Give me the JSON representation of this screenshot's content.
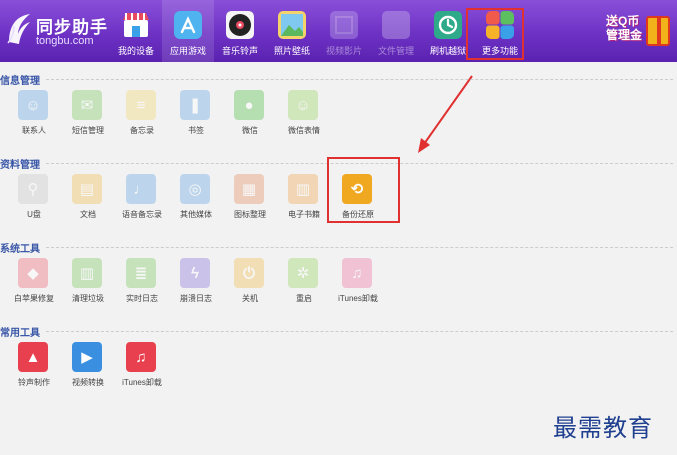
{
  "header": {
    "logo_title": "同步助手",
    "logo_sub": "tongbu.com",
    "nav": [
      {
        "label": "我的设备",
        "icon": "store-icon",
        "color": "#e84a5f"
      },
      {
        "label": "应用游戏",
        "icon": "appstore-icon",
        "color": "#3aa0e8"
      },
      {
        "label": "音乐铃声",
        "icon": "music-disc-icon",
        "color": "#222222"
      },
      {
        "label": "照片壁纸",
        "icon": "photo-icon",
        "color": "#5bb85c"
      },
      {
        "label": "视频影片",
        "icon": "video-icon",
        "color": "#8a7cc8"
      },
      {
        "label": "文件管理",
        "icon": "folder-icon",
        "color": "#a68bd0"
      },
      {
        "label": "刷机越狱",
        "icon": "flash-icon",
        "color": "#2eaa8a"
      },
      {
        "label": "更多功能",
        "icon": "more-icon",
        "color": "#f0a030"
      }
    ],
    "promo_text": "送Q币 管理金"
  },
  "sections": [
    {
      "title": "信息管理",
      "items": [
        {
          "label": "联系人",
          "icon": "contacts-icon",
          "color": "#7fb4e6",
          "glyph": "☺"
        },
        {
          "label": "短信管理",
          "icon": "sms-icon",
          "color": "#8fd07a",
          "glyph": "✉"
        },
        {
          "label": "备忘录",
          "icon": "memo-icon",
          "color": "#f0dc8a",
          "glyph": "≡"
        },
        {
          "label": "书签",
          "icon": "bookmark-icon",
          "color": "#7fb4e6",
          "glyph": "❚"
        },
        {
          "label": "微信",
          "icon": "wechat-icon",
          "color": "#6cc864",
          "glyph": "●"
        },
        {
          "label": "微信表情",
          "icon": "emoji-icon",
          "color": "#a8d87a",
          "glyph": "☺"
        }
      ]
    },
    {
      "title": "资料管理",
      "items": [
        {
          "label": "U盘",
          "icon": "usb-icon",
          "color": "#cfcfcf",
          "glyph": "⚲"
        },
        {
          "label": "文档",
          "icon": "document-icon",
          "color": "#f3c66a",
          "glyph": "▤"
        },
        {
          "label": "语音备忘录",
          "icon": "voice-memo-icon",
          "color": "#7fb4e6",
          "glyph": "♩"
        },
        {
          "label": "其他媒体",
          "icon": "media-icon",
          "color": "#7fb4e6",
          "glyph": "◎"
        },
        {
          "label": "图标整理",
          "icon": "icon-arrange-icon",
          "color": "#e8a07a",
          "glyph": "▦"
        },
        {
          "label": "电子书籍",
          "icon": "ebook-icon",
          "color": "#f0b36a",
          "glyph": "▥"
        },
        {
          "label": "备份还原",
          "icon": "backup-restore-icon",
          "color": "#f0a820",
          "glyph": "⟲"
        }
      ]
    },
    {
      "title": "系统工具",
      "items": [
        {
          "label": "白苹果修复",
          "icon": "apple-repair-icon",
          "color": "#ee7f8a",
          "glyph": "◆"
        },
        {
          "label": "清理垃圾",
          "icon": "trash-icon",
          "color": "#8fd07a",
          "glyph": "▥"
        },
        {
          "label": "实时日志",
          "icon": "log-icon",
          "color": "#8fd07a",
          "glyph": "≣"
        },
        {
          "label": "崩溃日志",
          "icon": "crash-log-icon",
          "color": "#9a8ae0",
          "glyph": "ϟ"
        },
        {
          "label": "关机",
          "icon": "power-icon",
          "color": "#f3c66a",
          "glyph": "⏻"
        },
        {
          "label": "重启",
          "icon": "restart-icon",
          "color": "#a8d87a",
          "glyph": "✲"
        },
        {
          "label": "iTunes卸载",
          "icon": "itunes-uninstall-icon",
          "color": "#ee8ab0",
          "glyph": "♫"
        }
      ]
    },
    {
      "title": "常用工具",
      "items": [
        {
          "label": "铃声制作",
          "icon": "ringtone-icon",
          "color": "#e8404f",
          "glyph": "▲"
        },
        {
          "label": "视频转换",
          "icon": "video-convert-icon",
          "color": "#3a8fe0",
          "glyph": "▶"
        },
        {
          "label": "iTunes卸载",
          "icon": "itunes-icon",
          "color": "#e8404f",
          "glyph": "♫"
        }
      ]
    }
  ],
  "watermark": "最需教育"
}
